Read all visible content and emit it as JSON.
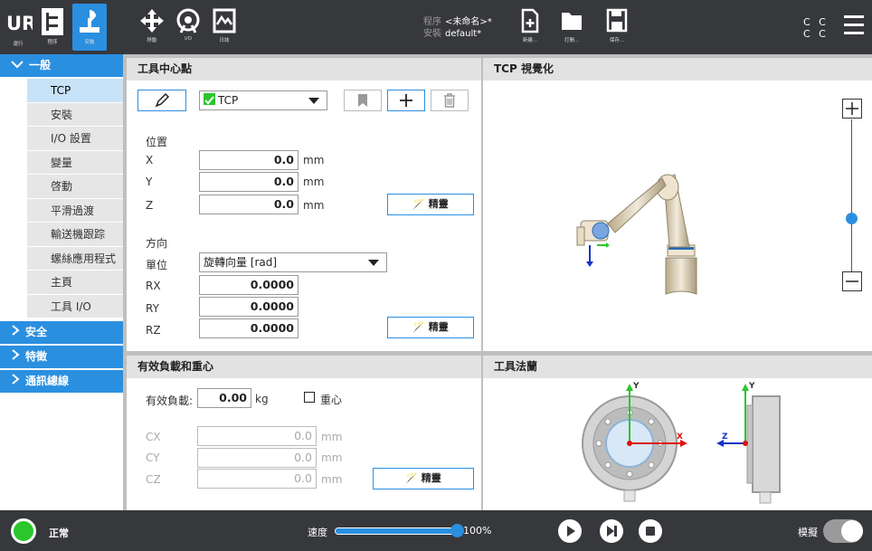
{
  "topbar": {
    "nav": [
      {
        "label": "運行"
      },
      {
        "label": "程序"
      },
      {
        "label": "安裝"
      }
    ],
    "tools": [
      {
        "label": "移動"
      },
      {
        "label": "I/O"
      },
      {
        "label": "日誌"
      }
    ],
    "program_key": "程序",
    "program_value": "<未命名>*",
    "install_key": "安裝",
    "install_value": "default*",
    "file_actions": [
      {
        "label": "新建..."
      },
      {
        "label": "打開..."
      },
      {
        "label": "保存..."
      }
    ],
    "cc_row1": "C C",
    "cc_row2": "C C"
  },
  "sidebar": {
    "general": "一般",
    "items": [
      {
        "label": "TCP"
      },
      {
        "label": "安裝"
      },
      {
        "label": "I/O 設置"
      },
      {
        "label": "變量"
      },
      {
        "label": "啓動"
      },
      {
        "label": "平滑過渡"
      },
      {
        "label": "輸送機跟踪"
      },
      {
        "label": "螺絲應用程式"
      },
      {
        "label": "主頁"
      },
      {
        "label": "工具 I/O"
      }
    ],
    "sections": [
      {
        "label": "安全"
      },
      {
        "label": "特徵"
      },
      {
        "label": "通訊總線"
      }
    ]
  },
  "tcp_panel": {
    "title": "工具中心點",
    "tcp_name": "TCP",
    "position_label": "位置",
    "x_label": "X",
    "x_value": "0.0",
    "y_label": "Y",
    "y_value": "0.0",
    "z_label": "Z",
    "z_value": "0.0",
    "mm": "mm",
    "wizard": "精靈",
    "orientation_label": "方向",
    "unit_label": "單位",
    "unit_value": "旋轉向量 [rad]",
    "rx_label": "RX",
    "rx_value": "0.0000",
    "ry_label": "RY",
    "ry_value": "0.0000",
    "rz_label": "RZ",
    "rz_value": "0.0000"
  },
  "visual_panel": {
    "title": "TCP 視覺化",
    "zoom_level": 0.35
  },
  "payload_panel": {
    "title": "有效負載和重心",
    "payload_label": "有效負載:",
    "payload_value": "0.00",
    "kg": "kg",
    "cog_label": "重心",
    "cx_label": "CX",
    "cx_value": "0.0",
    "cy_label": "CY",
    "cy_value": "0.0",
    "cz_label": "CZ",
    "cz_value": "0.0",
    "mm": "mm",
    "wizard": "精靈"
  },
  "flange_panel": {
    "title": "工具法蘭",
    "y_axis": "Y",
    "x_axis": "X",
    "z_axis": "Z"
  },
  "bottombar": {
    "status": "正常",
    "speed_label": "速度",
    "speed_value": "100%",
    "speed_fraction": 1.0,
    "sim_label": "模擬"
  },
  "colors": {
    "accent": "#2b8fe0",
    "bar": "#37383c",
    "status_green": "#2cc62c"
  }
}
